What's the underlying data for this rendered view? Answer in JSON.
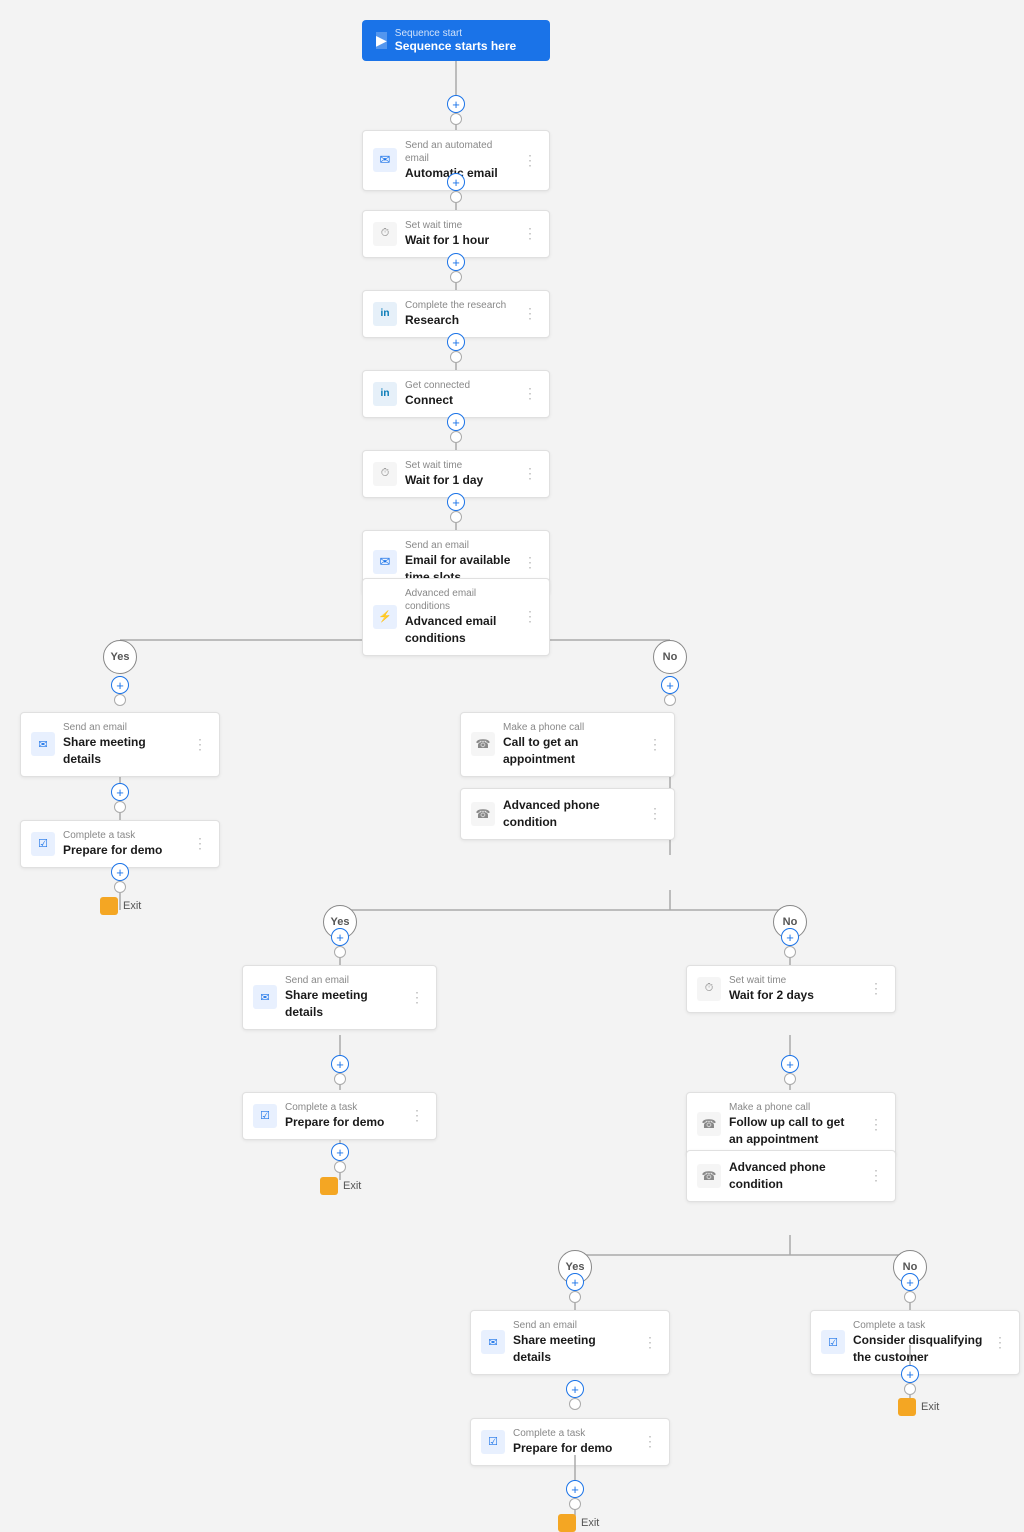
{
  "nodes": {
    "sequence_start": {
      "label": "Sequence start",
      "title": "Sequence starts here",
      "icon": "▶",
      "type": "start"
    },
    "automatic_email": {
      "label": "Send an automated email",
      "title": "Automatic email",
      "icon": "✉",
      "type": "card"
    },
    "wait_1hour": {
      "label": "Set wait time",
      "title": "Wait for 1 hour",
      "icon": "⏱",
      "type": "card"
    },
    "research": {
      "label": "Complete the research",
      "title": "Research",
      "icon": "in",
      "type": "card"
    },
    "connect": {
      "label": "Get connected",
      "title": "Connect",
      "icon": "in",
      "type": "card"
    },
    "wait_1day": {
      "label": "Set wait time",
      "title": "Wait for 1 day",
      "icon": "⏱",
      "type": "card"
    },
    "email_timeslots": {
      "label": "Send an email",
      "title": "Email for available time slots",
      "icon": "✉",
      "type": "card"
    },
    "advanced_email_conditions": {
      "label": "Advanced email conditions",
      "title": "Advanced email conditions",
      "icon": "⚡",
      "type": "card"
    },
    "yes_share_meeting": {
      "label": "Send an email",
      "title": "Share meeting details",
      "icon": "✉",
      "type": "card"
    },
    "yes_prepare_demo": {
      "label": "Complete a task",
      "title": "Prepare for demo",
      "icon": "☑",
      "type": "card"
    },
    "no_call_appointment": {
      "label": "Make a phone call",
      "title": "Call to get an appointment",
      "icon": "☎",
      "type": "card"
    },
    "advanced_phone_1": {
      "label": "",
      "title": "Advanced phone condition",
      "icon": "☎",
      "type": "card"
    },
    "yes2_share_meeting": {
      "label": "Send an email",
      "title": "Share meeting details",
      "icon": "✉",
      "type": "card"
    },
    "yes2_prepare_demo": {
      "label": "Complete a task",
      "title": "Prepare for demo",
      "icon": "☑",
      "type": "card"
    },
    "no2_wait_2days": {
      "label": "Set wait time",
      "title": "Wait for 2 days",
      "icon": "⏱",
      "type": "card"
    },
    "no2_followup_call": {
      "label": "Make a phone call",
      "title": "Follow up call to get an appointment",
      "icon": "☎",
      "type": "card"
    },
    "advanced_phone_2": {
      "label": "",
      "title": "Advanced phone condition",
      "icon": "☎",
      "type": "card"
    },
    "yes3_share_meeting": {
      "label": "Send an email",
      "title": "Share meeting details",
      "icon": "✉",
      "type": "card"
    },
    "yes3_prepare_demo": {
      "label": "Complete a task",
      "title": "Prepare for demo",
      "icon": "☑",
      "type": "card"
    },
    "no3_disqualify": {
      "label": "Complete a task",
      "title": "Consider disqualifying the customer",
      "icon": "☑",
      "type": "card"
    }
  },
  "labels": {
    "yes": "Yes",
    "no": "No",
    "exit": "Exit"
  },
  "colors": {
    "blue": "#1a73e8",
    "line": "#aaa",
    "orange": "#f4a623",
    "card_border": "#e0e0e0"
  }
}
